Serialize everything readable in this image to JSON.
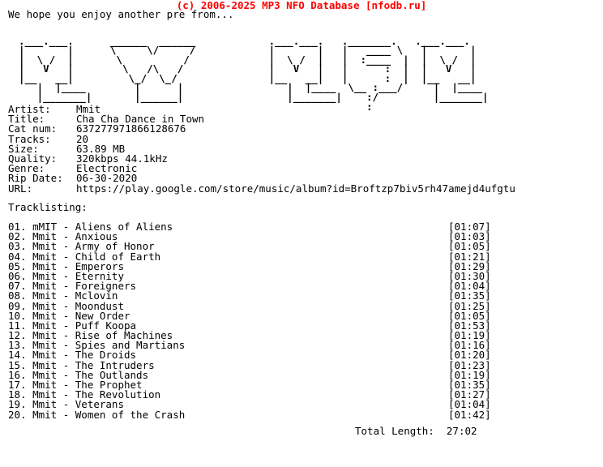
{
  "header": {
    "copyright_banner": "(c) 2006-2025 MP3 NFO Database [nfodb.ru]",
    "banner_color": "#ff0000",
    "greeting": "We hope you enjoy another pre from..."
  },
  "ascii_logo": {
    "alt_text": "MY MOM",
    "art": "  .___.___.      ______  ______            .___.___.   ._______.   .___.___.\n  |       |      \\     \\/     /            |       |   |   ____ \\   |       |\n  |  \\ /  |       \\          /             |  \\ /  |   |  :____  |  |  \\ /  |\n  |   V   |        \\   /\\   /              |   V   |   |      :  |  |   V   |\n  |__   __|         \\_/  \\_/               |__   __|   |      :  |  |__   __|\n     |  |____        |      |                 |  |____  \\__ :___/     |  |____\n     |_______|       |______|                 |_______|    :/         |_______|\n                                                           :"
  },
  "info": {
    "rows": [
      {
        "label": "Artist:",
        "value": "Mmit"
      },
      {
        "label": "Title:",
        "value": "Cha Cha Dance in Town"
      },
      {
        "label": "Cat num:",
        "value": "637277971866128676"
      },
      {
        "label": "Tracks:",
        "value": "20"
      },
      {
        "label": "Size:",
        "value": "63.89 MB"
      },
      {
        "label": "Quality:",
        "value": "320kbps 44.1kHz"
      },
      {
        "label": "Genre:",
        "value": "Electronic"
      },
      {
        "label": "Rip Date:",
        "value": "06-30-2020"
      },
      {
        "label": "URL:",
        "value": "https://play.google.com/store/music/album?id=Broftzp7biv5rh47amejd4ufgtu"
      }
    ]
  },
  "tracklisting": {
    "heading": "Tracklisting:",
    "tracks": [
      {
        "num": "01.",
        "artist": "mMIT",
        "title": "Aliens of Aliens",
        "time": "[01:07]"
      },
      {
        "num": "02.",
        "artist": "Mmit",
        "title": "Anxious",
        "time": "[01:03]"
      },
      {
        "num": "03.",
        "artist": "Mmit",
        "title": "Army of Honor",
        "time": "[01:05]"
      },
      {
        "num": "04.",
        "artist": "Mmit",
        "title": "Child of Earth",
        "time": "[01:21]"
      },
      {
        "num": "05.",
        "artist": "Mmit",
        "title": "Emperors",
        "time": "[01:29]"
      },
      {
        "num": "06.",
        "artist": "Mmit",
        "title": "Eternity",
        "time": "[01:30]"
      },
      {
        "num": "07.",
        "artist": "Mmit",
        "title": "Foreigners",
        "time": "[01:04]"
      },
      {
        "num": "08.",
        "artist": "Mmit",
        "title": "Mclovin",
        "time": "[01:35]"
      },
      {
        "num": "09.",
        "artist": "Mmit",
        "title": "Moondust",
        "time": "[01:25]"
      },
      {
        "num": "10.",
        "artist": "Mmit",
        "title": "New Order",
        "time": "[01:05]"
      },
      {
        "num": "11.",
        "artist": "Mmit",
        "title": "Puff Koopa",
        "time": "[01:53]"
      },
      {
        "num": "12.",
        "artist": "Mmit",
        "title": "Rise of Machines",
        "time": "[01:19]"
      },
      {
        "num": "13.",
        "artist": "Mmit",
        "title": "Spies and Martians",
        "time": "[01:16]"
      },
      {
        "num": "14.",
        "artist": "Mmit",
        "title": "The Droids",
        "time": "[01:20]"
      },
      {
        "num": "15.",
        "artist": "Mmit",
        "title": "The Intruders",
        "time": "[01:23]"
      },
      {
        "num": "16.",
        "artist": "Mmit",
        "title": "The Outlands",
        "time": "[01:19]"
      },
      {
        "num": "17.",
        "artist": "Mmit",
        "title": "The Prophet",
        "time": "[01:35]"
      },
      {
        "num": "18.",
        "artist": "Mmit",
        "title": "The Revolution",
        "time": "[01:27]"
      },
      {
        "num": "19.",
        "artist": "Mmit",
        "title": "Veterans",
        "time": "[01:04]"
      },
      {
        "num": "20.",
        "artist": "Mmit",
        "title": "Women of the Crash",
        "time": "[01:42]"
      }
    ]
  },
  "footer": {
    "total_length_label": "Total Length:",
    "total_length_value": "27:02"
  }
}
